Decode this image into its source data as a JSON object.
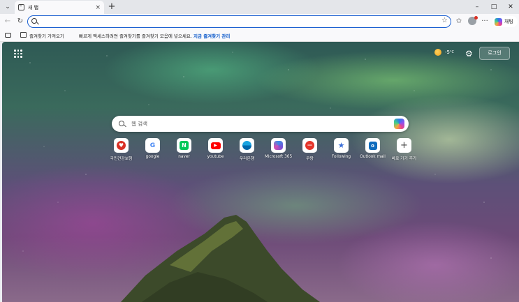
{
  "browser": {
    "tab_title": "새 탭",
    "tab_close": "×",
    "new_tab": "+",
    "window_controls": {
      "minimize": "–",
      "maximize": "□",
      "close": "✕"
    },
    "address_value": "",
    "copilot_label": "채팅",
    "more_label": "···"
  },
  "favorites_bar": {
    "import_label": "즐겨찾기 가져오기",
    "message": "빠르게 액세스하려면 즐겨찾기를 즐겨찾기 모음에 넣으세요.",
    "link": "지금 즐겨찾기 관리"
  },
  "newtab": {
    "weather_temp": "-5",
    "weather_unit": "°C",
    "login_label": "로그인",
    "search_placeholder": "웹 검색",
    "shortcuts": [
      {
        "label": "국민건강보험",
        "icon": "heart-icon",
        "color": "#d93025"
      },
      {
        "label": "google",
        "icon": "google-icon",
        "color": "#4285f4"
      },
      {
        "label": "naver",
        "icon": "naver-icon",
        "color": "#03c75a"
      },
      {
        "label": "youtube",
        "icon": "youtube-icon",
        "color": "#ff0000"
      },
      {
        "label": "우리은행",
        "icon": "woori-icon",
        "color": "#0067ac"
      },
      {
        "label": "Microsoft 365",
        "icon": "m365-icon",
        "color": "#5a5fd6"
      },
      {
        "label": "쿠팡",
        "icon": "coupang-icon",
        "color": "#e5352b"
      },
      {
        "label": "Following",
        "icon": "following-icon",
        "color": "#3b6fd8"
      },
      {
        "label": "Outlook mail",
        "icon": "outlook-icon",
        "color": "#0f6cbd"
      },
      {
        "label": "바로 가기 추가",
        "icon": "plus-icon",
        "color": "#444444"
      }
    ]
  }
}
